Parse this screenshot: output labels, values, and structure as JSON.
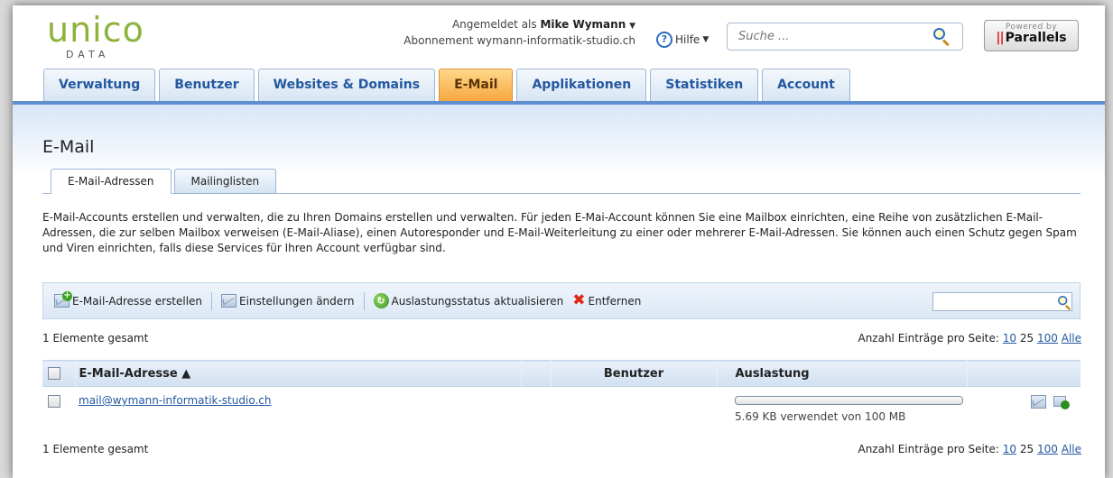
{
  "header": {
    "logo_main": "unico",
    "logo_sub": "DATA",
    "logged_in_prefix": "Angemeldet als",
    "user_name": "Mike Wymann",
    "subscription": "Abonnement wymann-informatik-studio.ch",
    "help_label": "Hilfe",
    "search_placeholder": "Suche ...",
    "powered_by": "Powered by",
    "parallels_brand": "Parallels"
  },
  "nav": {
    "tabs": [
      {
        "label": "Verwaltung"
      },
      {
        "label": "Benutzer"
      },
      {
        "label": "Websites & Domains"
      },
      {
        "label": "E-Mail"
      },
      {
        "label": "Applikationen"
      },
      {
        "label": "Statistiken"
      },
      {
        "label": "Account"
      }
    ],
    "active": "E-Mail"
  },
  "page": {
    "title": "E-Mail",
    "subtabs": [
      {
        "label": "E-Mail-Adressen"
      },
      {
        "label": "Mailinglisten"
      }
    ],
    "description": "E-Mail-Accounts erstellen und verwalten, die zu Ihren Domains erstellen und verwalten. Für jeden E-Mai-Account können Sie eine Mailbox einrichten, eine Reihe von zusätzlichen E-Mail-Adressen, die zur selben Mailbox verweisen (E-Mail-Aliase), einen Autoresponder und E-Mail-Weiterleitung zu einer oder mehrerer E-Mail-Adressen. Sie können auch einen Schutz gegen Spam und Viren einrichten, falls diese Services für Ihren Account verfügbar sind."
  },
  "toolbar": {
    "create": "E-Mail-Adresse erstellen",
    "settings": "Einstellungen ändern",
    "refresh": "Auslastungsstatus aktualisieren",
    "remove": "Entfernen"
  },
  "list": {
    "count_text": "1 Elemente gesamt",
    "per_page_label": "Anzahl Einträge pro Seite:",
    "per_page_10": "10",
    "per_page_25": "25",
    "per_page_100": "100",
    "per_page_all": "Alle",
    "columns": {
      "email": "E-Mail-Adresse ▲",
      "user": "Benutzer",
      "usage": "Auslastung"
    },
    "rows": [
      {
        "email": "mail@wymann-informatik-studio.ch",
        "user": "",
        "usage_fraction": 0.0001,
        "usage_text": "5.69 KB verwendet von 100 MB"
      }
    ]
  },
  "colors": {
    "logo_green": "#8db33b",
    "tab_blue": "#2358a0",
    "active_tab_orange": "#f7a740",
    "link_blue": "#2358a0",
    "remove_red": "#e02616"
  }
}
